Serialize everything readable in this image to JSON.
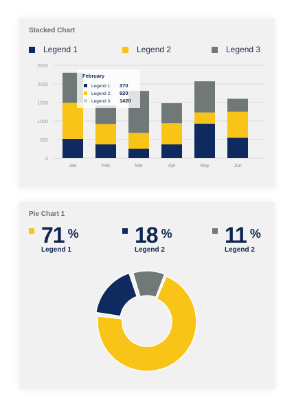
{
  "colors": {
    "navy": "#0f2a5e",
    "yellow": "#f7c417",
    "gray": "#717878"
  },
  "stacked": {
    "title": "Stacked Chart",
    "legend": [
      "Legend 1",
      "Legend 2",
      "Legend 3"
    ]
  },
  "tooltip": {
    "title": "February",
    "rows": [
      {
        "label": "Legend 1:",
        "value": "370"
      },
      {
        "label": "Legend 2:",
        "value": "920"
      },
      {
        "label": "Legend 3:",
        "value": "1420"
      }
    ]
  },
  "pie_card": {
    "title": "Pie Chart 1",
    "stats": [
      {
        "value": "71",
        "unit": "%",
        "label": "Legend 1"
      },
      {
        "value": "18",
        "unit": "%",
        "label": "Legend 2"
      },
      {
        "value": "11",
        "unit": "%",
        "label": "Legend 2"
      }
    ]
  },
  "chart_data": [
    {
      "type": "bar",
      "stacked": true,
      "categories": [
        "Jan",
        "Feb",
        "Mar",
        "Apr",
        "May",
        "Jun"
      ],
      "series": [
        {
          "name": "Legend 1",
          "values": [
            520,
            370,
            250,
            370,
            930,
            550
          ]
        },
        {
          "name": "Legend 2",
          "values": [
            970,
            550,
            430,
            570,
            300,
            700
          ]
        },
        {
          "name": "Legend 3",
          "values": [
            810,
            500,
            1130,
            540,
            840,
            350
          ]
        }
      ],
      "yticks": [
        0,
        500,
        1000,
        1500,
        2000,
        2500
      ],
      "ylim": [
        0,
        2500
      ],
      "grid": true,
      "legend_position": "top"
    },
    {
      "type": "pie",
      "donut": true,
      "series": [
        {
          "name": "Legend 1",
          "value": 71
        },
        {
          "name": "Legend 2",
          "value": 18
        },
        {
          "name": "Legend 3",
          "value": 11
        }
      ]
    }
  ]
}
